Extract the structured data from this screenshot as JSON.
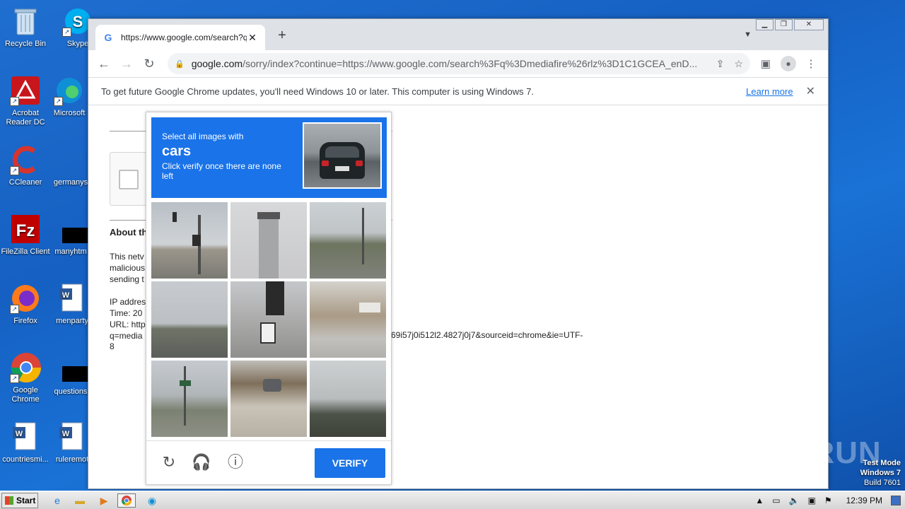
{
  "desktop": {
    "icons": [
      {
        "label": "Recycle Bin",
        "icon": "recycle-bin-icon"
      },
      {
        "label": "Skype",
        "icon": "skype-icon"
      },
      {
        "label": "Acrobat Reader DC",
        "icon": "acrobat-icon"
      },
      {
        "label": "Microsoft",
        "icon": "edge-icon"
      },
      {
        "label": "CCleaner",
        "icon": "ccleaner-icon"
      },
      {
        "label": "germanys",
        "icon": "file-icon"
      },
      {
        "label": "FileZilla Client",
        "icon": "filezilla-icon"
      },
      {
        "label": "manyhtm",
        "icon": "file-icon"
      },
      {
        "label": "Firefox",
        "icon": "firefox-icon"
      },
      {
        "label": "menparty",
        "icon": "word-doc-icon"
      },
      {
        "label": "Google Chrome",
        "icon": "chrome-icon"
      },
      {
        "label": "questions",
        "icon": "file-icon"
      },
      {
        "label": "countriesmi...",
        "icon": "word-doc-icon"
      },
      {
        "label": "ruleremot",
        "icon": "word-doc-icon"
      }
    ]
  },
  "browser": {
    "tab_title": "https://www.google.com/search?q=",
    "url_host": "google.com",
    "url_rest": "/sorry/index?continue=https://www.google.com/search%3Fq%3Dmediafire%26rlz%3D1C1GCEA_enD...",
    "infobar": {
      "message": "To get future Google Chrome updates, you'll need Windows 10 or later. This computer is using Windows 7.",
      "link": "Learn more"
    }
  },
  "page": {
    "about_heading": "About th",
    "para1": [
      "This netv",
      "malicious",
      "sending t"
    ],
    "para2": [
      "IP addres",
      "Time: 20",
      "URL: http",
      "q=media"
    ],
    "url_tail": "69i57j0i512l2.4827j0j7&sourceid=chrome&ie=UTF-",
    "url_end": "8"
  },
  "captcha": {
    "instruction_line1": "Select all images with",
    "target": "cars",
    "instruction_line3": "Click verify once there are none left",
    "verify_label": "VERIFY"
  },
  "watermark": "ANY RUN",
  "test_mode": {
    "line1": "Test Mode",
    "line2": "Windows 7",
    "line3": "Build 7601"
  },
  "taskbar": {
    "start_label": "Start",
    "clock": "12:39 PM"
  }
}
